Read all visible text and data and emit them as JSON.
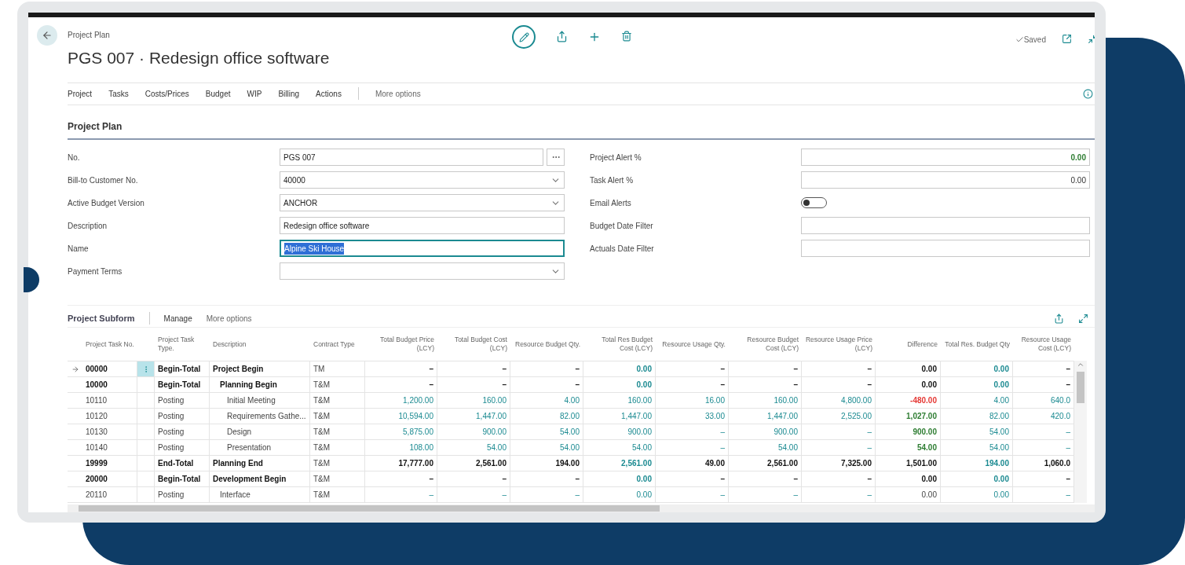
{
  "header": {
    "breadcrumb": "Project Plan",
    "title": "PGS 007 · Redesign office software",
    "status": "Saved"
  },
  "action_bar": {
    "items": [
      "Project",
      "Tasks",
      "Costs/Prices",
      "Budget",
      "WIP",
      "Billing",
      "Actions"
    ],
    "more": "More options"
  },
  "section": {
    "title": "Project Plan"
  },
  "left_fields": [
    {
      "label": "No.",
      "value": "PGS 007",
      "kind": "assist",
      "focused": false
    },
    {
      "label": "Bill-to Customer No.",
      "value": "40000",
      "kind": "dropdown",
      "focused": false
    },
    {
      "label": "Active Budget Version",
      "value": "ANCHOR",
      "kind": "dropdown",
      "focused": false
    },
    {
      "label": "Description",
      "value": "Redesign office software",
      "kind": "text",
      "focused": false
    },
    {
      "label": "Name",
      "value": "Alpine Ski House",
      "kind": "text",
      "focused": true
    },
    {
      "label": "Payment Terms",
      "kind": "dropdown",
      "focused": false
    }
  ],
  "right_fields": [
    {
      "label": "Project Alert %",
      "value": "0.00",
      "kind": "number",
      "highlighted": true
    },
    {
      "label": "Task Alert %",
      "value": "0.00",
      "kind": "number",
      "highlighted": false
    },
    {
      "label": "Email Alerts",
      "kind": "toggle",
      "on": false
    },
    {
      "label": "Budget Date Filter",
      "kind": "text"
    },
    {
      "label": "Actuals Date Filter",
      "kind": "text"
    }
  ],
  "subform": {
    "title": "Project Subform",
    "actions": [
      "Manage",
      "More options"
    ]
  },
  "table": {
    "columns": [
      "Project Task No.",
      "Project Task Type.",
      "Description",
      "Contract Type",
      "Total Budget Price (LCY)",
      "Total Budget Cost (LCY)",
      "Resource Budget Qty.",
      "Total Res Budget Cost (LCY)",
      "Resource Usage Qty.",
      "Resource Budget Cost (LCY)",
      "Resource Usage Price (LCY)",
      "Difference",
      "Total Res. Budget Qty",
      "Resource Usage Cost (LCY)"
    ],
    "rows": [
      {
        "bold": true,
        "selected": true,
        "cells": [
          {
            "text": "00000",
            "kind": "plain"
          },
          {
            "text": "Begin-Total",
            "kind": "plain"
          },
          {
            "text": "Project Begin",
            "kind": "plain"
          },
          {
            "text": "TM",
            "kind": "plain"
          },
          {
            "text": "–",
            "kind": "plain"
          },
          {
            "text": "–",
            "kind": "plain"
          },
          {
            "text": "–",
            "kind": "plain"
          },
          {
            "text": "0.00",
            "kind": "link"
          },
          {
            "text": "–",
            "kind": "plain"
          },
          {
            "text": "–",
            "kind": "plain"
          },
          {
            "text": "–",
            "kind": "plain"
          },
          {
            "text": "0.00",
            "kind": "strong"
          },
          {
            "text": "0.00",
            "kind": "link"
          },
          {
            "text": "–",
            "kind": "plain"
          }
        ],
        "children": [
          {
            "bold": true,
            "selected": false,
            "cells": [
              {
                "text": "10000",
                "kind": "plain"
              },
              {
                "text": "Begin-Total",
                "kind": "plain"
              },
              {
                "text": "Planning Begin",
                "kind": "plain"
              },
              {
                "text": "T&M",
                "kind": "plain"
              },
              {
                "text": "–",
                "kind": "plain"
              },
              {
                "text": "–",
                "kind": "plain"
              },
              {
                "text": "–",
                "kind": "plain"
              },
              {
                "text": "0.00",
                "kind": "link"
              },
              {
                "text": "–",
                "kind": "plain"
              },
              {
                "text": "–",
                "kind": "plain"
              },
              {
                "text": "–",
                "kind": "plain"
              },
              {
                "text": "0.00",
                "kind": "strong"
              },
              {
                "text": "0.00",
                "kind": "link"
              },
              {
                "text": "–",
                "kind": "plain"
              }
            ],
            "children": [
              {
                "bold": false,
                "selected": false,
                "cells": [
                  {
                    "text": "10110",
                    "kind": "plain"
                  },
                  {
                    "text": "Posting",
                    "kind": "plain"
                  },
                  {
                    "text": "Initial Meeting",
                    "kind": "plain"
                  },
                  {
                    "text": "T&M",
                    "kind": "plain"
                  },
                  {
                    "text": "1,200.00",
                    "kind": "link"
                  },
                  {
                    "text": "160.00",
                    "kind": "link"
                  },
                  {
                    "text": "4.00",
                    "kind": "link"
                  },
                  {
                    "text": "160.00",
                    "kind": "link"
                  },
                  {
                    "text": "16.00",
                    "kind": "link"
                  },
                  {
                    "text": "160.00",
                    "kind": "link"
                  },
                  {
                    "text": "4,800.00",
                    "kind": "link"
                  },
                  {
                    "text": "-480.00",
                    "kind": "negative"
                  },
                  {
                    "text": "4.00",
                    "kind": "link"
                  },
                  {
                    "text": "640.0",
                    "kind": "link"
                  }
                ]
              },
              {
                "bold": false,
                "selected": false,
                "cells": [
                  {
                    "text": "10120",
                    "kind": "plain"
                  },
                  {
                    "text": "Posting",
                    "kind": "plain"
                  },
                  {
                    "text": "Requirements Gathe...",
                    "kind": "plain"
                  },
                  {
                    "text": "T&M",
                    "kind": "plain"
                  },
                  {
                    "text": "10,594.00",
                    "kind": "link"
                  },
                  {
                    "text": "1,447.00",
                    "kind": "link"
                  },
                  {
                    "text": "82.00",
                    "kind": "link"
                  },
                  {
                    "text": "1,447.00",
                    "kind": "link"
                  },
                  {
                    "text": "33.00",
                    "kind": "link"
                  },
                  {
                    "text": "1,447.00",
                    "kind": "link"
                  },
                  {
                    "text": "2,525.00",
                    "kind": "link"
                  },
                  {
                    "text": "1,027.00",
                    "kind": "positive"
                  },
                  {
                    "text": "82.00",
                    "kind": "link"
                  },
                  {
                    "text": "420.0",
                    "kind": "link"
                  }
                ]
              },
              {
                "bold": false,
                "selected": false,
                "cells": [
                  {
                    "text": "10130",
                    "kind": "plain"
                  },
                  {
                    "text": "Posting",
                    "kind": "plain"
                  },
                  {
                    "text": "Design",
                    "kind": "plain"
                  },
                  {
                    "text": "T&M",
                    "kind": "plain"
                  },
                  {
                    "text": "5,875.00",
                    "kind": "link"
                  },
                  {
                    "text": "900.00",
                    "kind": "link"
                  },
                  {
                    "text": "54.00",
                    "kind": "link"
                  },
                  {
                    "text": "900.00",
                    "kind": "link"
                  },
                  {
                    "text": "–",
                    "kind": "link"
                  },
                  {
                    "text": "900.00",
                    "kind": "link"
                  },
                  {
                    "text": "–",
                    "kind": "link"
                  },
                  {
                    "text": "900.00",
                    "kind": "positive"
                  },
                  {
                    "text": "54.00",
                    "kind": "link"
                  },
                  {
                    "text": "–",
                    "kind": "link"
                  }
                ]
              },
              {
                "bold": false,
                "selected": false,
                "cells": [
                  {
                    "text": "10140",
                    "kind": "plain"
                  },
                  {
                    "text": "Posting",
                    "kind": "plain"
                  },
                  {
                    "text": "Presentation",
                    "kind": "plain"
                  },
                  {
                    "text": "T&M",
                    "kind": "plain"
                  },
                  {
                    "text": "108.00",
                    "kind": "link"
                  },
                  {
                    "text": "54.00",
                    "kind": "link"
                  },
                  {
                    "text": "54.00",
                    "kind": "link"
                  },
                  {
                    "text": "54.00",
                    "kind": "link"
                  },
                  {
                    "text": "–",
                    "kind": "link"
                  },
                  {
                    "text": "54.00",
                    "kind": "link"
                  },
                  {
                    "text": "–",
                    "kind": "link"
                  },
                  {
                    "text": "54.00",
                    "kind": "positive"
                  },
                  {
                    "text": "54.00",
                    "kind": "link"
                  },
                  {
                    "text": "–",
                    "kind": "link"
                  }
                ]
              }
            ]
          }
        ]
      },
      {
        "bold": true,
        "selected": false,
        "cells": [
          {
            "text": "19999",
            "kind": "plain"
          },
          {
            "text": "End-Total",
            "kind": "plain"
          },
          {
            "text": "Planning End",
            "kind": "plain"
          },
          {
            "text": "T&M",
            "kind": "plain"
          },
          {
            "text": "17,777.00",
            "kind": "strong"
          },
          {
            "text": "2,561.00",
            "kind": "strong"
          },
          {
            "text": "194.00",
            "kind": "strong"
          },
          {
            "text": "2,561.00",
            "kind": "link"
          },
          {
            "text": "49.00",
            "kind": "strong"
          },
          {
            "text": "2,561.00",
            "kind": "strong"
          },
          {
            "text": "7,325.00",
            "kind": "strong"
          },
          {
            "text": "1,501.00",
            "kind": "strong"
          },
          {
            "text": "194.00",
            "kind": "link"
          },
          {
            "text": "1,060.0",
            "kind": "strong"
          }
        ]
      },
      {
        "bold": true,
        "selected": false,
        "cells": [
          {
            "text": "20000",
            "kind": "plain"
          },
          {
            "text": "Begin-Total",
            "kind": "plain"
          },
          {
            "text": "Development Begin",
            "kind": "plain"
          },
          {
            "text": "T&M",
            "kind": "plain"
          },
          {
            "text": "–",
            "kind": "plain"
          },
          {
            "text": "–",
            "kind": "plain"
          },
          {
            "text": "–",
            "kind": "plain"
          },
          {
            "text": "0.00",
            "kind": "link"
          },
          {
            "text": "–",
            "kind": "plain"
          },
          {
            "text": "–",
            "kind": "plain"
          },
          {
            "text": "–",
            "kind": "plain"
          },
          {
            "text": "0.00",
            "kind": "strong"
          },
          {
            "text": "0.00",
            "kind": "link"
          },
          {
            "text": "–",
            "kind": "plain"
          }
        ],
        "children": [
          {
            "bold": false,
            "selected": false,
            "cells": [
              {
                "text": "20110",
                "kind": "plain"
              },
              {
                "text": "Posting",
                "kind": "plain"
              },
              {
                "text": "Interface",
                "kind": "plain"
              },
              {
                "text": "T&M",
                "kind": "plain"
              },
              {
                "text": "–",
                "kind": "link"
              },
              {
                "text": "–",
                "kind": "link"
              },
              {
                "text": "–",
                "kind": "link"
              },
              {
                "text": "0.00",
                "kind": "link"
              },
              {
                "text": "–",
                "kind": "link"
              },
              {
                "text": "–",
                "kind": "link"
              },
              {
                "text": "–",
                "kind": "link"
              },
              {
                "text": "0.00",
                "kind": "plain"
              },
              {
                "text": "0.00",
                "kind": "link"
              },
              {
                "text": "–",
                "kind": "link"
              }
            ]
          }
        ]
      }
    ]
  }
}
